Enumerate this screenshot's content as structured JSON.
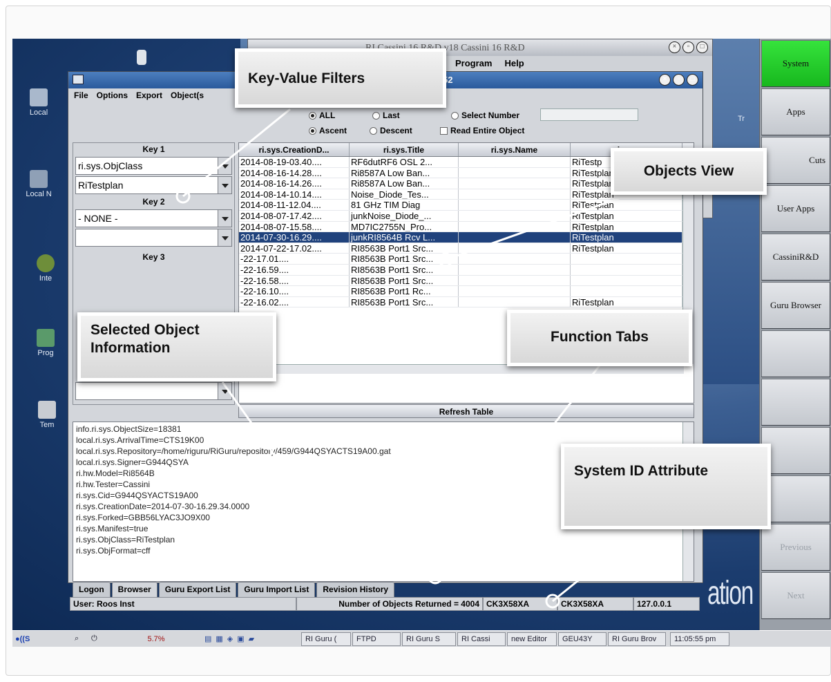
{
  "back_window": {
    "title": "RI Cassini 16 R&D v18  Cassini 16 R&D",
    "menu": [
      "Program",
      "Help"
    ]
  },
  "main_window": {
    "title": "52",
    "menu": [
      "File",
      "Options",
      "Export",
      "Object(s"
    ],
    "options": {
      "all": "ALL",
      "last": "Last",
      "select_number": "Select Number",
      "ascent": "Ascent",
      "descent": "Descent",
      "read_entire": "Read Entire Object"
    },
    "keys": {
      "key1_label": "Key 1",
      "key1_field": "ri.sys.ObjClass",
      "key1_value": "RiTestplan",
      "key2_label": "Key 2",
      "key2_field": "- NONE -",
      "key2_value": "",
      "key3_label": "Key 3"
    },
    "table": {
      "columns": [
        "ri.sys.CreationD...",
        "ri.sys.Title",
        "ri.sys.Name",
        "ri.sys."
      ],
      "rows": [
        [
          "2014-08-19-03.40....",
          "RF6dutRF6 OSL 2...",
          "",
          "RiTestp"
        ],
        [
          "2014-08-16-14.28....",
          "Ri8587A Low Ban...",
          "",
          "RiTestplan"
        ],
        [
          "2014-08-16-14.26....",
          "Ri8587A Low Ban...",
          "",
          "RiTestplan"
        ],
        [
          "2014-08-14-10.14....",
          "Noise_Diode_Tes...",
          "",
          "RiTestplan"
        ],
        [
          "2014-08-11-12.04....",
          "81 GHz TIM Diag",
          "",
          "RiTestplan"
        ],
        [
          "2014-08-07-17.42....",
          "junkNoise_Diode_...",
          "",
          "RiTestplan"
        ],
        [
          "2014-08-07-15.58....",
          "MD7IC2755N_Pro...",
          "",
          "RiTestplan"
        ],
        [
          "2014-07-30-16.29....",
          "junkRI8564B Rcv L...",
          "",
          "RiTestplan"
        ],
        [
          "2014-07-22-17.02....",
          "RI8563B Port1 Src...",
          "",
          "RiTestplan"
        ],
        [
          "-22-17.01....",
          "RI8563B Port1 Src...",
          "",
          ""
        ],
        [
          "-22-16.59....",
          "RI8563B Port1 Src...",
          "",
          ""
        ],
        [
          "-22-16.58....",
          "RI8563B Port1 Src...",
          "",
          ""
        ],
        [
          "-22-16.10....",
          "RI8563B Port1 Rc...",
          "",
          ""
        ],
        [
          "-22-16.02....",
          "RI8563B Port1 Src...",
          "",
          "RiTestplan"
        ]
      ],
      "selected_row": 7,
      "refresh": "Refresh Table"
    },
    "info_lines": [
      "info.ri.sys.ObjectSize=18381",
      "local.ri.sys.ArrivalTime=CTS19K00",
      "local.ri.sys.Repository=/home/riguru/RiGuru/repository/459/G944QSYACTS19A00.gat",
      "local.ri.sys.Signer=G944QSYA",
      "ri.hw.Model=Ri8564B",
      "ri.hw.Tester=Cassini",
      "ri.sys.Cid=G944QSYACTS19A00",
      "ri.sys.CreationDate=2014-07-30-16.29.34.0000",
      "ri.sys.Forked=GBB56LYAC3JO9X00",
      "ri.sys.Manifest=true",
      "ri.sys.ObjClass=RiTestplan",
      "ri.sys.ObjFormat=cff"
    ],
    "tabs": [
      "Logon",
      "Browser",
      "Guru Export List",
      "Guru Import List",
      "Revision History"
    ],
    "active_tab": "Browser",
    "status": {
      "user": "User:  Roos Inst",
      "objects_returned": "Number of Objects Returned =  4004",
      "system_id_1": "CK3X58XA",
      "system_id_2": "CK3X58XA",
      "ip": "127.0.0.1"
    }
  },
  "desktop_icons": [
    "Local",
    "Local N",
    "Inte",
    "Prog",
    "Tem",
    "Tr"
  ],
  "right_panel": [
    "System",
    "Apps",
    "Cuts",
    "User Apps",
    "CassiniR&D",
    "Guru Browser",
    "",
    "",
    "",
    "",
    "Previous",
    "Next"
  ],
  "brand_text": "ation",
  "taskbar": {
    "cpu": "5.7%",
    "items": [
      "RI Guru (",
      "FTPD",
      "RI Guru S",
      "RI Cassi",
      "new Editor",
      "GEU43Y",
      "RI Guru Brov"
    ],
    "clock": "11:05:55 pm"
  },
  "callouts": {
    "key_value_filters": "Key-Value Filters",
    "objects_view": "Objects View",
    "selected_object": "Selected Object Information",
    "function_tabs": "Function Tabs",
    "system_id": "System ID Attribute"
  },
  "colors": {
    "system_button": "#17b81e",
    "selected_row": "#20427c",
    "titlebar": "#2a5a9c"
  }
}
